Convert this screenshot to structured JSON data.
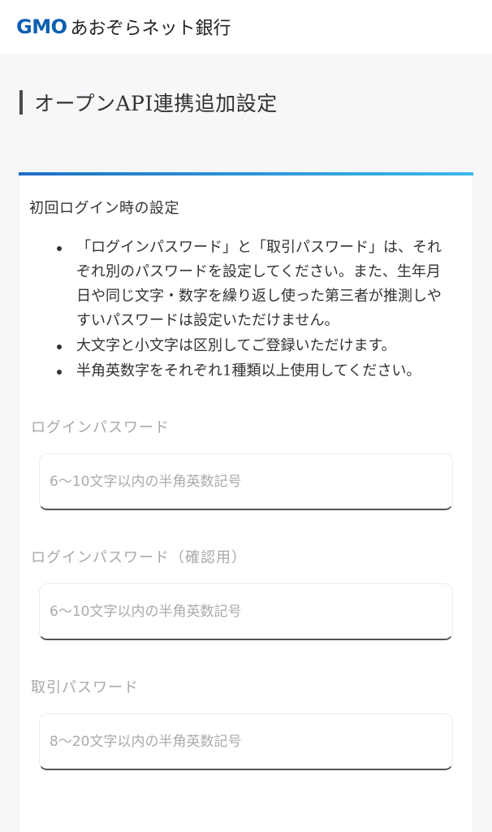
{
  "header": {
    "logo_mark": "GMO",
    "logo_text": "あおぞらネット銀行"
  },
  "page": {
    "title": "オープンAPI連携追加設定"
  },
  "card": {
    "section_title": "初回ログイン時の設定",
    "rules": [
      "「ログインパスワード」と「取引パスワード」は、それぞれ別のパスワードを設定してください。また、生年月日や同じ文字・数字を繰り返し使った第三者が推測しやすいパスワードは設定いただけません。",
      "大文字と小文字は区別してご登録いただけます。",
      "半角英数字をそれぞれ1種類以上使用してください。"
    ],
    "fields": [
      {
        "label": "ログインパスワード",
        "placeholder": "6〜10文字以内の半角英数記号"
      },
      {
        "label": "ログインパスワード（確認用）",
        "placeholder": "6〜10文字以内の半角英数記号"
      },
      {
        "label": "取引パスワード",
        "placeholder": "8〜20文字以内の半角英数記号"
      }
    ]
  },
  "colors": {
    "accent_start": "#1d6fc4",
    "accent_end": "#3bb9ea",
    "brand": "#0b5fb0"
  }
}
